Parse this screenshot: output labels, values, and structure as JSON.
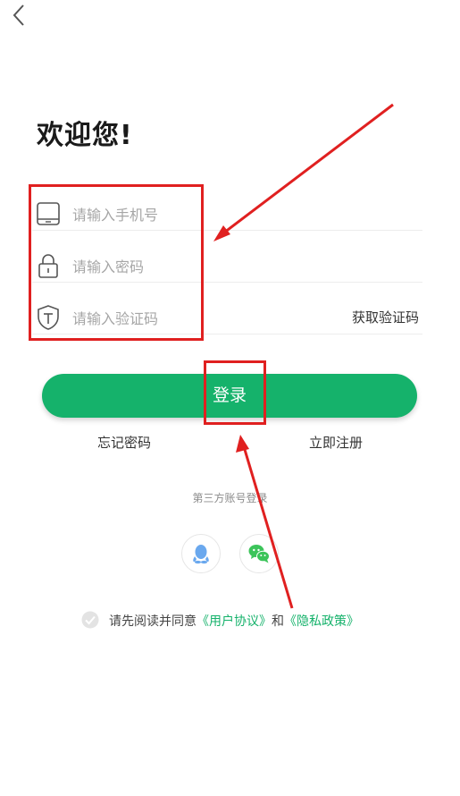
{
  "header": {
    "back_icon": "chevron-left-icon"
  },
  "title": "欢迎您!",
  "form": {
    "phone": {
      "icon": "phone-icon",
      "placeholder": "请输入手机号",
      "value": ""
    },
    "password": {
      "icon": "lock-icon",
      "placeholder": "请输入密码",
      "value": ""
    },
    "code": {
      "icon": "shield-icon",
      "placeholder": "请输入验证码",
      "value": "",
      "get_code_label": "获取验证码"
    }
  },
  "login_label": "登录",
  "links": {
    "forgot_password": "忘记密码",
    "register": "立即注册"
  },
  "third_party": {
    "label": "第三方账号登录",
    "providers": [
      {
        "icon": "qq-icon"
      },
      {
        "icon": "wechat-icon"
      }
    ]
  },
  "agreement": {
    "checked": true,
    "prefix": "请先阅读并同意",
    "user_agreement": "《用户协议》",
    "and": "和",
    "privacy_policy": "《隐私政策》"
  },
  "colors": {
    "accent": "#15b26b",
    "annotation": "#e02020"
  }
}
